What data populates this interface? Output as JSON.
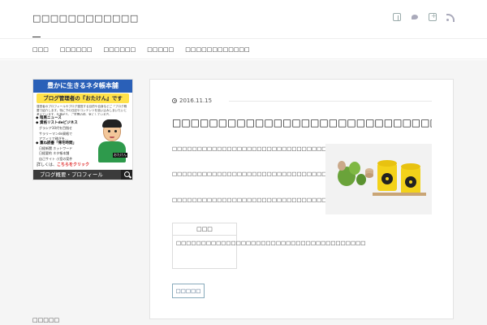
{
  "header": {
    "site_title": "□□□□□□□□□□□□",
    "social": [
      "facebook-icon",
      "twitter-icon",
      "google-plus-icon",
      "rss-icon"
    ]
  },
  "nav": {
    "items": [
      "□□□",
      "□□□□□□",
      "□□□□□□",
      "□□□□□",
      "□□□□□□□□□□□□"
    ]
  },
  "sidebar": {
    "banner": {
      "title": "豊かに生きるネタ帳本舗",
      "subtitle": "ブログ管理者の『おたけん』です",
      "description": "運営者のプロフィールやブログ運営する目的や自身などご「ブログ概要で紹介します。特に下の日記やコンテンツを追い込みしまいたいと考えています。仕事がら、ご質問の前、気にしている方。",
      "list": [
        {
          "text": "◆ 暗黒ニュース",
          "bold": true
        },
        {
          "text": "◆ 資格リストdeビジネス",
          "bold": true
        },
        {
          "text": "グラシア30代を目指せ",
          "bold": false
        },
        {
          "text": "サラリーマンde資格で",
          "bold": false
        },
        {
          "text": "アフィリで稼ぎを…",
          "bold": false
        },
        {
          "text": "◆ 重ね読書「帰宅時間」",
          "bold": true
        },
        {
          "text": "日経新聞 ホットワード",
          "bold": false
        },
        {
          "text": "日経要約  ネタ帳本舗",
          "bold": false
        },
        {
          "text": "自己サイト 小室の案件",
          "bold": false
        }
      ],
      "avatar_tag": "おたけん",
      "cta_prefix": "詳しくは、",
      "cta_link": "こちらをクリック",
      "bottom_label": "ブログ概要・プロフィール"
    },
    "heading": "□□□□□"
  },
  "post": {
    "date": "2016.11.15",
    "title": "□□□□□□□□□□□□□□□□□□□□□□□□□□□□□□□□□□□",
    "paragraphs": [
      "□□□□□□□□□□□□□□□□□□□□□□□□□□□□□□□□□□□□□□□□□□□□□□□□□□",
      "□□□□□□□□□□□□□□□□□□□□□□□□□□□□□□□□□□□□□□□□□□□□□□□□",
      "□□□□□□□□□□□□□□□□□□□□□□□□□□□□□□□□□□□□□□□"
    ],
    "toc_heading": "□□□",
    "toc_body": "□□□□□□□□□□□□□□□□□□□□□□□□□□□□□□□□□□□□□□",
    "more_label": "□□□□□"
  }
}
